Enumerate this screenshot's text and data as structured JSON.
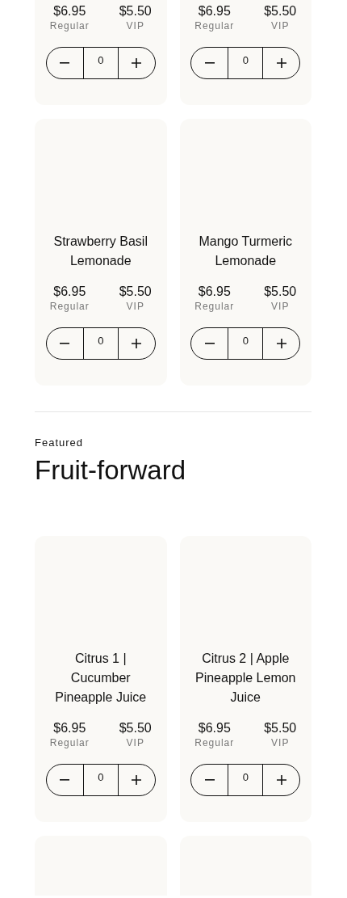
{
  "sections": [
    {
      "products": [
        {
          "kind": "top_cut",
          "regular_price": "$6.95",
          "regular_label": "Regular",
          "vip_price": "$5.50",
          "vip_label": "VIP",
          "quantity": "0"
        },
        {
          "kind": "top_cut",
          "regular_price": "$6.95",
          "regular_label": "Regular",
          "vip_price": "$5.50",
          "vip_label": "VIP",
          "quantity": "0"
        },
        {
          "kind": "full",
          "name": "Strawberry Basil Lemonade",
          "regular_price": "$6.95",
          "regular_label": "Regular",
          "vip_price": "$5.50",
          "vip_label": "VIP",
          "quantity": "0"
        },
        {
          "kind": "full",
          "name": "Mango Turmeric Lemonade",
          "regular_price": "$6.95",
          "regular_label": "Regular",
          "vip_price": "$5.50",
          "vip_label": "VIP",
          "quantity": "0"
        }
      ]
    },
    {
      "eyebrow": "Featured",
      "title": "Fruit-forward",
      "products": [
        {
          "kind": "full",
          "name": "Citrus 1 | Cucumber Pineapple Juice",
          "regular_price": "$6.95",
          "regular_label": "Regular",
          "vip_price": "$5.50",
          "vip_label": "VIP",
          "quantity": "0"
        },
        {
          "kind": "full",
          "name": "Citrus 2 | Apple Pineapple Lemon Juice",
          "regular_price": "$6.95",
          "regular_label": "Regular",
          "vip_price": "$5.50",
          "vip_label": "VIP",
          "quantity": "0"
        },
        {
          "kind": "bottom_cut"
        },
        {
          "kind": "bottom_cut"
        }
      ]
    }
  ]
}
